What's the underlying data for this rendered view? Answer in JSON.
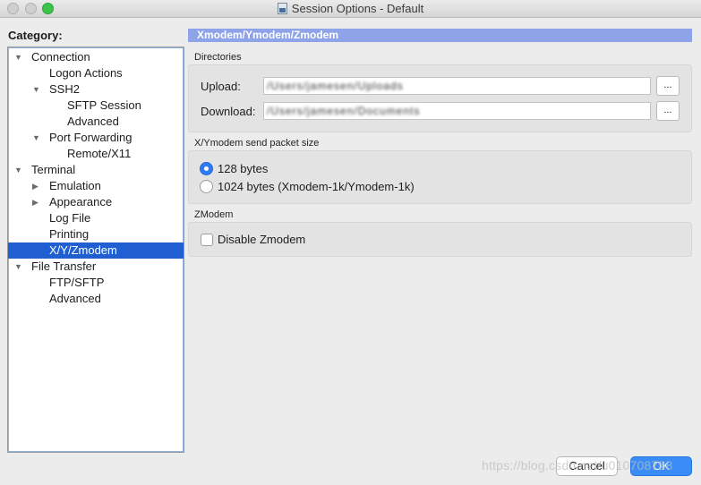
{
  "window": {
    "title": "Session Options - Default"
  },
  "sidebar": {
    "label": "Category:",
    "items": [
      {
        "label": "Connection",
        "arrow": "▼",
        "selected": false
      },
      {
        "label": "Logon Actions",
        "arrow": "",
        "selected": false
      },
      {
        "label": "SSH2",
        "arrow": "▼",
        "selected": false
      },
      {
        "label": "SFTP Session",
        "arrow": "",
        "selected": false
      },
      {
        "label": "Advanced",
        "arrow": "",
        "selected": false
      },
      {
        "label": "Port Forwarding",
        "arrow": "▼",
        "selected": false
      },
      {
        "label": "Remote/X11",
        "arrow": "",
        "selected": false
      },
      {
        "label": "Terminal",
        "arrow": "▼",
        "selected": false
      },
      {
        "label": "Emulation",
        "arrow": "▶",
        "selected": false
      },
      {
        "label": "Appearance",
        "arrow": "▶",
        "selected": false
      },
      {
        "label": "Log File",
        "arrow": "",
        "selected": false
      },
      {
        "label": "Printing",
        "arrow": "",
        "selected": false
      },
      {
        "label": "X/Y/Zmodem",
        "arrow": "",
        "selected": true
      },
      {
        "label": "File Transfer",
        "arrow": "▼",
        "selected": false
      },
      {
        "label": "FTP/SFTP",
        "arrow": "",
        "selected": false
      },
      {
        "label": "Advanced",
        "arrow": "",
        "selected": false
      }
    ]
  },
  "main": {
    "header": "Xmodem/Ymodem/Zmodem",
    "directories": {
      "label": "Directories",
      "upload_label": "Upload:",
      "upload_value": "/Users/jamesen/Uploads",
      "download_label": "Download:",
      "download_value": "/Users/jamesen/Documents",
      "browse_label": "..."
    },
    "packet_size": {
      "label": "X/Ymodem send packet size",
      "option_128": "128 bytes",
      "option_1024": "1024 bytes (Xmodem-1k/Ymodem-1k)",
      "selected": "128 bytes"
    },
    "zmodem": {
      "label": "ZModem",
      "disable_label": "Disable Zmodem",
      "disable_checked": false
    }
  },
  "footer": {
    "cancel_label": "Cancel",
    "ok_label": "OK",
    "watermark": "https://blog.csdn.net/u010708758"
  },
  "colors": {
    "selection": "#1f5fd1",
    "header_bar": "#8fa4e8",
    "accent_blue": "#3a8cf6"
  }
}
